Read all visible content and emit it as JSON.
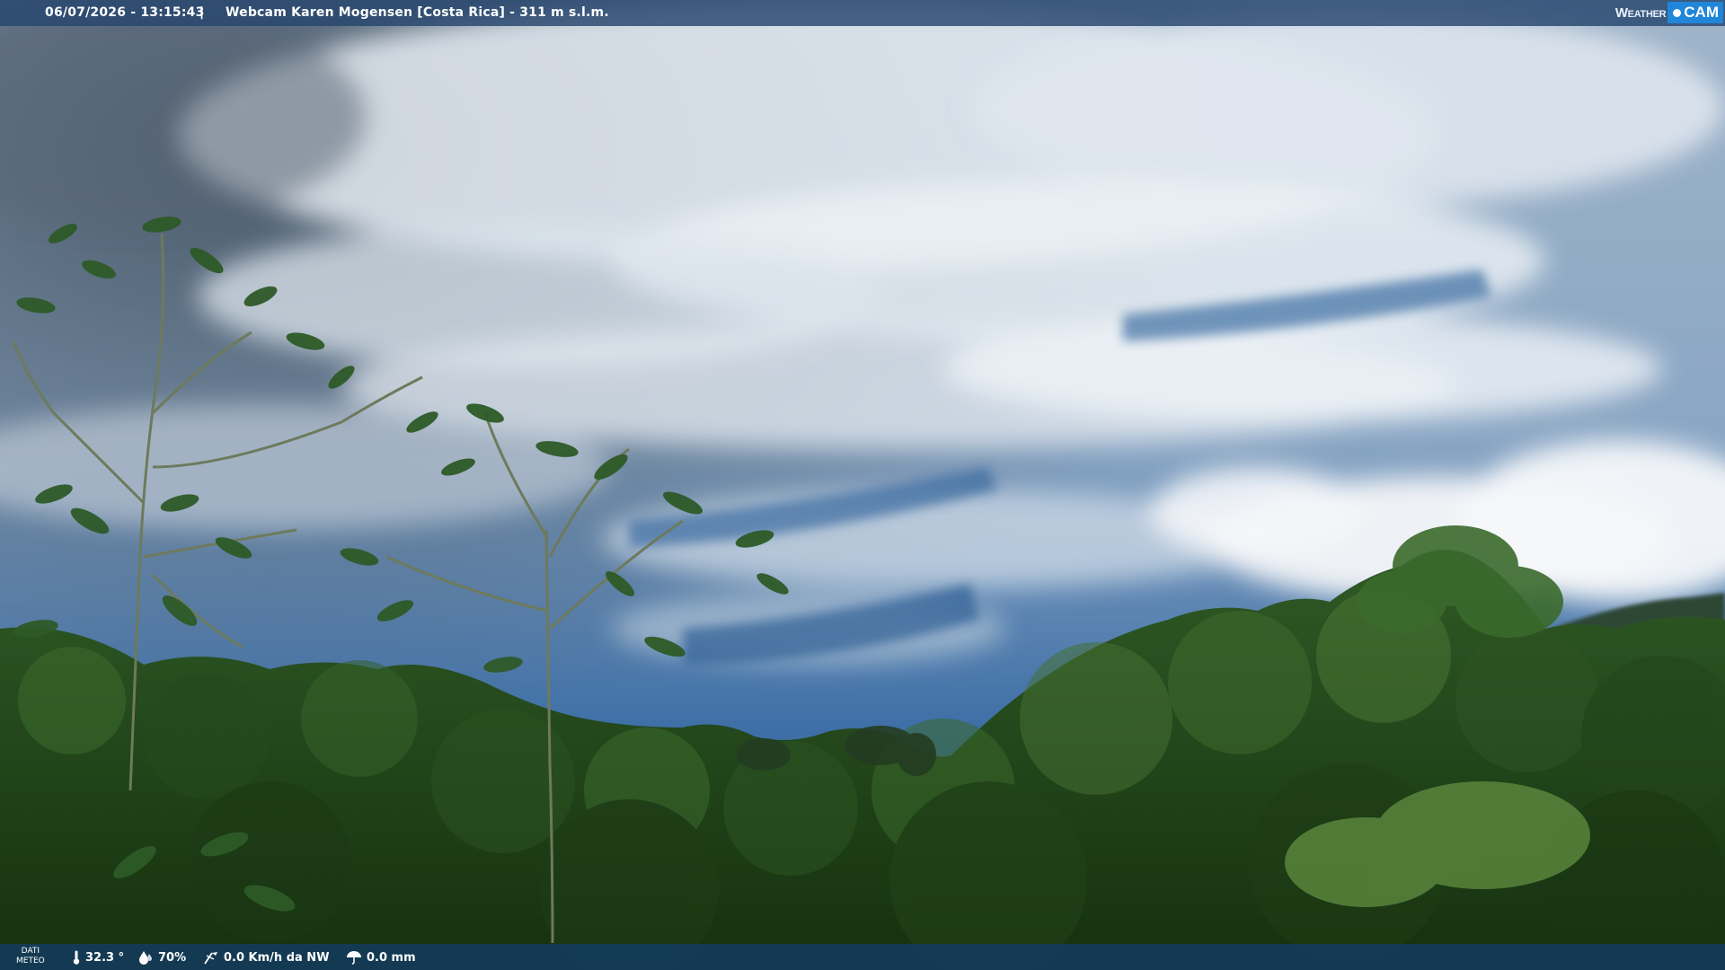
{
  "header": {
    "datetime": "06/07/2026 - 13:15:43",
    "separator": "|",
    "title": "Webcam Karen Mogensen [Costa Rica] - 311 m s.l.m.",
    "logo_weather": "Weather",
    "logo_cam": "CAM"
  },
  "weather": {
    "label_line1": "DATI",
    "label_line2": "METEO",
    "temperature": "32.3 °",
    "humidity": "70%",
    "wind": "0.0 Km/h da NW",
    "rain": "0.0 mm"
  },
  "icons": {
    "temperature": "thermometer-icon",
    "humidity": "humidity-drop-icon",
    "wind": "wind-icon",
    "rain": "rain-umbrella-icon"
  },
  "colors": {
    "top_bar": "#26466e",
    "bottom_bar": "#143c5f",
    "logo_accent": "#1f86d9",
    "sky": "#4f7fb0",
    "foliage": "#1f3f18"
  }
}
